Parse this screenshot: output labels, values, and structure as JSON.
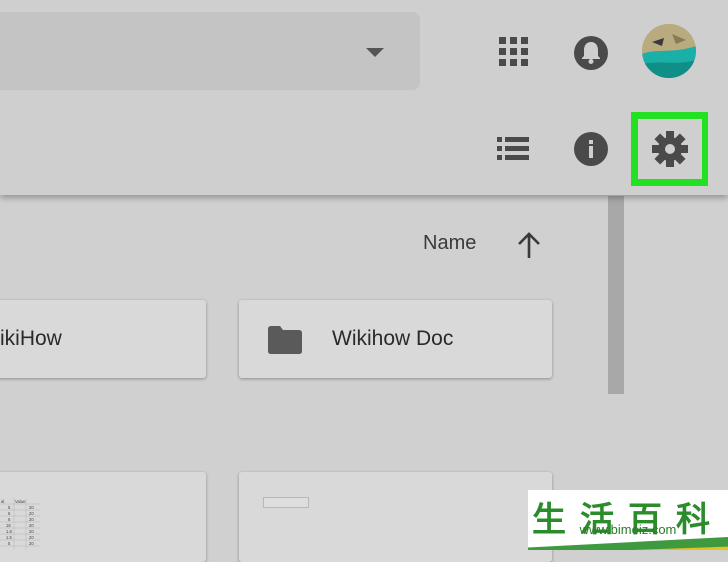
{
  "header": {
    "search": {
      "dropdown_icon": "triangle-down-icon"
    },
    "icons": {
      "apps": "grid-apps-icon",
      "notifications": "bell-icon",
      "account": "avatar",
      "list_view": "list-view-icon",
      "details": "info-icon",
      "settings": "gear-icon"
    },
    "highlight_color": "#23e023"
  },
  "sort": {
    "label": "Name",
    "direction_icon": "arrow-up-icon"
  },
  "folders": [
    {
      "name": "ikiHow"
    },
    {
      "name": "Wikihow Doc",
      "icon": "folder-icon"
    }
  ],
  "files": [
    {
      "preview_type": "spreadsheet",
      "table": {
        "headers": [
          "al",
          "Value"
        ],
        "rows": [
          [
            "5",
            "20"
          ],
          [
            "6",
            "20"
          ],
          [
            "5",
            "20"
          ],
          [
            "16",
            "20"
          ],
          [
            "1.8",
            "20"
          ],
          [
            "1.5",
            "20"
          ],
          [
            "5",
            "20"
          ]
        ]
      }
    },
    {
      "preview_type": "document"
    }
  ],
  "watermark": {
    "chars": "生活百科",
    "url": "www.bimeiz.com"
  }
}
